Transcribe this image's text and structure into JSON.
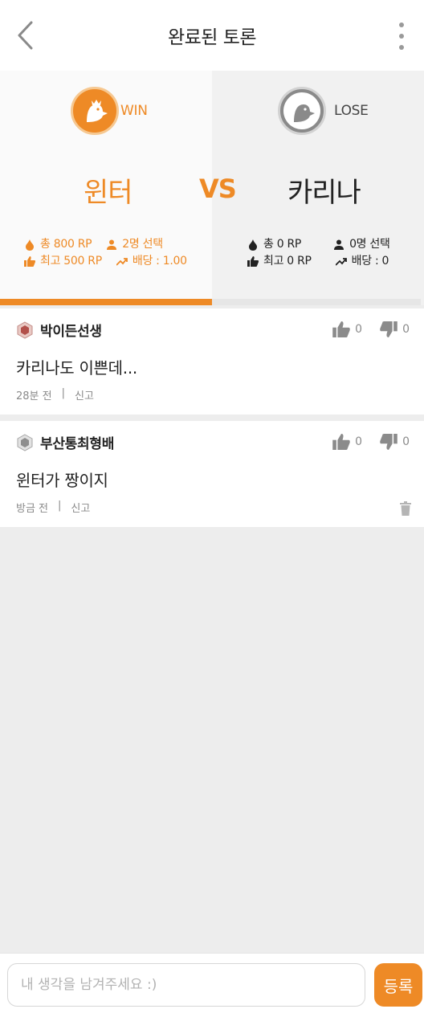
{
  "header": {
    "title": "완료된 토론"
  },
  "debate": {
    "left": {
      "result": "WIN",
      "name": "윈터",
      "total_rp": "총 800 RP",
      "max_rp": "최고 500 RP",
      "picks": "2명 선택",
      "odds": "배당 : 1.00"
    },
    "vs": "VS",
    "right": {
      "result": "LOSE",
      "name": "카리나",
      "total_rp": "총 0 RP",
      "max_rp": "최고 0 RP",
      "picks": "0명 선택",
      "odds": "배당 : 0"
    }
  },
  "comments": [
    {
      "author": "박이든선생",
      "text": "카리나도 이쁜데...",
      "time": "28분 전",
      "report": "신고",
      "likes": "0",
      "dislikes": "0"
    },
    {
      "author": "부산통최형배",
      "text": "윈터가 짱이지",
      "time": "방금 전",
      "report": "신고",
      "likes": "0",
      "dislikes": "0"
    }
  ],
  "composer": {
    "placeholder": "내 생각을 남겨주세요 :)",
    "submit_label": "등록"
  },
  "colors": {
    "accent": "#ee8a26",
    "win": "#ee8a26",
    "lose": "#222222"
  }
}
